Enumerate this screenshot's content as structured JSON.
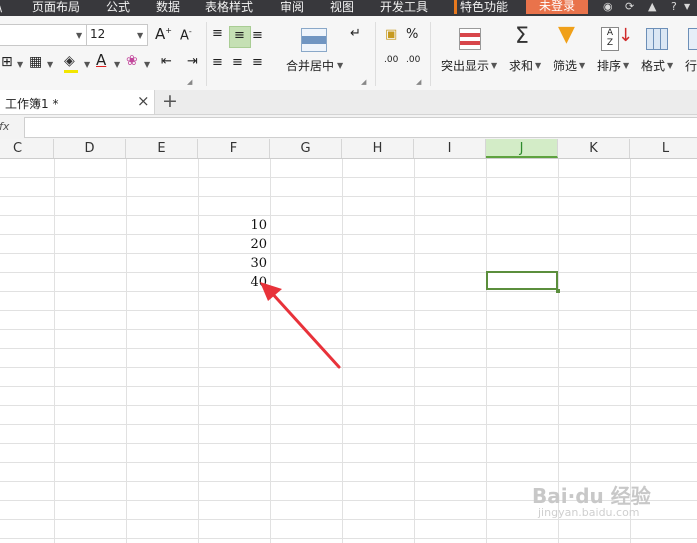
{
  "menubar": {
    "items": [
      "页面布局",
      "公式",
      "数据",
      "表格样式",
      "审阅",
      "视图",
      "开发工具",
      "特色功能"
    ],
    "login": "未登录",
    "partial": "\\"
  },
  "ribbon": {
    "font_size": "12",
    "merge_label": "合并居中",
    "percent": "%",
    "dec_add": ".00",
    "dec_sub": ".00",
    "highlight_label": "突出显示",
    "sum_label": "求和",
    "filter_label": "筛选",
    "sort_label": "排序",
    "format_label": "格式",
    "row_label": "行",
    "grow_font": "A",
    "shrink_font": "A",
    "font_color": "A"
  },
  "tabs": {
    "doc_name": "工作簿1 *",
    "close": "×",
    "add": "+"
  },
  "formula": {
    "fx": "fx",
    "value": ""
  },
  "grid": {
    "columns": [
      "C",
      "D",
      "E",
      "F",
      "G",
      "H",
      "I",
      "J",
      "K",
      "L"
    ],
    "active_column": "J",
    "values": [
      "10",
      "20",
      "30",
      "40"
    ]
  },
  "watermark": {
    "main": "Bai·du 经验",
    "sub": "jingyan.baidu.com"
  },
  "colors": {
    "menubar_bg": "#38383c",
    "accent_orange": "#e9734b",
    "selection_green": "#5b8e3c",
    "arrow_red": "#e8323a"
  }
}
